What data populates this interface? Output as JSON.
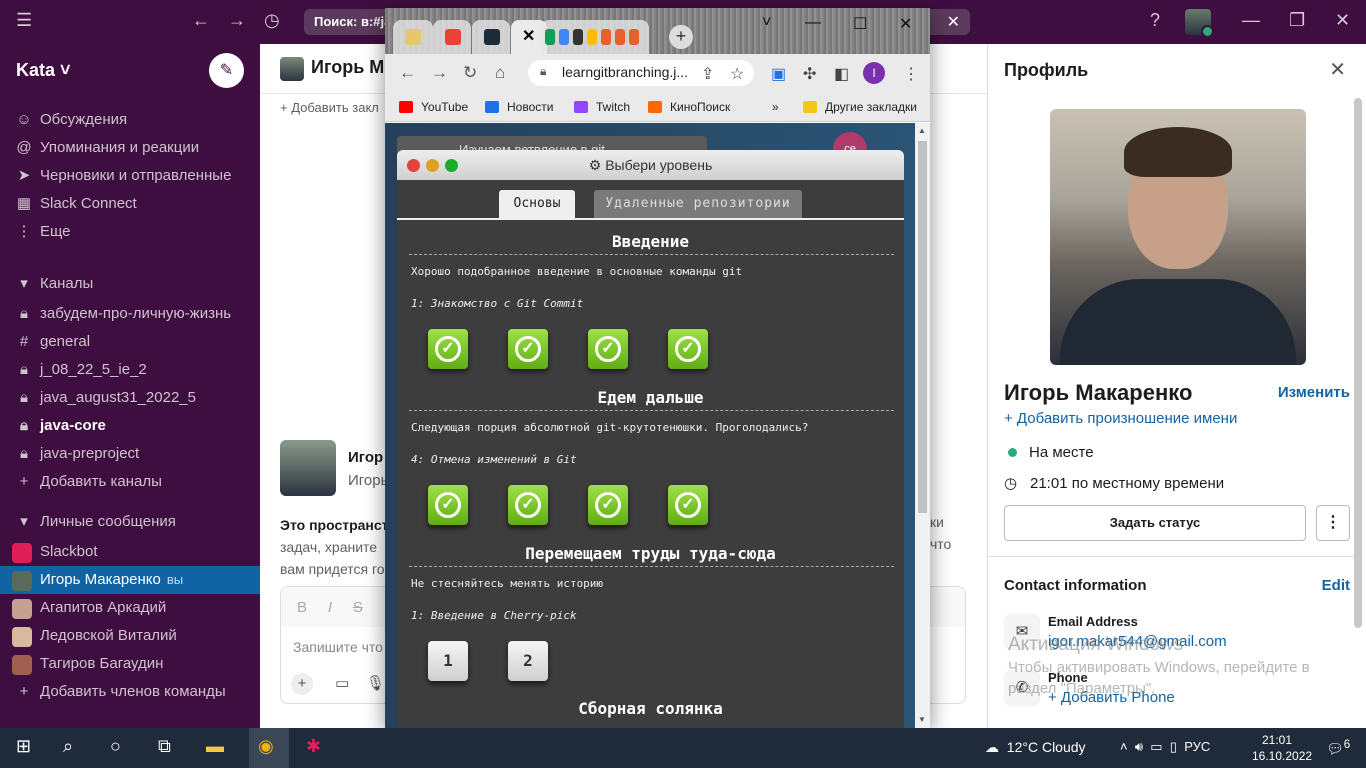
{
  "slack": {
    "search": "Поиск: в:#ja",
    "workspace": "Kata",
    "nav": [
      {
        "icon": "threads-icon",
        "label": "Обсуждения"
      },
      {
        "icon": "mentions-icon",
        "label": "Упоминания и реакции"
      },
      {
        "icon": "drafts-icon",
        "label": "Черновики и отправленные"
      },
      {
        "icon": "slack-connect-icon",
        "label": "Slack Connect"
      },
      {
        "icon": "more-icon",
        "label": "Еще"
      }
    ],
    "channels_header": "Каналы",
    "channels": [
      {
        "prefix": "🔒",
        "label": "забудем-про-личную-жизнь"
      },
      {
        "prefix": "#",
        "label": "general"
      },
      {
        "prefix": "🔒",
        "label": "j_08_22_5_ie_2"
      },
      {
        "prefix": "🔒",
        "label": "java_august31_2022_5"
      },
      {
        "prefix": "🔒",
        "label": "java-core"
      },
      {
        "prefix": "🔒",
        "label": "java-preproject"
      }
    ],
    "add_channels": "Добавить каналы",
    "dms_header": "Личные сообщения",
    "dms": [
      {
        "label": "Slackbot",
        "color": "#4a154b"
      },
      {
        "label": "Игорь Макаренко",
        "you": "вы",
        "color": "#5a6a5a"
      },
      {
        "label": "Агапитов Аркадий",
        "color": "#c8a090"
      },
      {
        "label": "Ледовской Виталий",
        "color": "#d8b8a0"
      },
      {
        "label": "Тагиров Багаудин",
        "color": "#a06050"
      }
    ],
    "add_members": "Добавить членов команды"
  },
  "main": {
    "title": "Игорь Ма",
    "bookmark": "+ Добавить закл",
    "intro_name": "Игор",
    "intro_sub": "Игорь",
    "desc_line1_bold": "Это пространст",
    "desc_line2": "задач, храните",
    "desc_line3": "вам придется го",
    "desc_right1": "ки",
    "desc_right2": "что",
    "placeholder": "Запишите что"
  },
  "profile": {
    "header": "Профиль",
    "name": "Игорь Макаренко",
    "edit": "Изменить",
    "pronunciation": "+ Добавить произношение имени",
    "status": "На месте",
    "local_time": "21:01 по местному времени",
    "set_status": "Задать статус",
    "more": "⋮",
    "contact_header": "Contact information",
    "contact_edit": "Edit",
    "email_label": "Email Address",
    "email": "igor.makar544@gmail.com",
    "phone_label": "Phone",
    "add_phone": "+ Добавить Phone",
    "activation_title": "Активация Windows",
    "activation_text": "Чтобы активировать Windows, перейдите в раздел \"Параметры\"."
  },
  "chrome": {
    "url": "learngitbranching.j...",
    "bookmarks": [
      {
        "label": "YouTube",
        "color": "#ff0000"
      },
      {
        "label": "Новости",
        "color": "#1a73e8"
      },
      {
        "label": "Twitch",
        "color": "#9146ff"
      },
      {
        "label": "КиноПоиск",
        "color": "#ff6600"
      }
    ],
    "bookmarks_more": "»",
    "other_bookmarks": "Другие закладки",
    "profile_letter": "I",
    "behind_window": "Изучаем ветвление в git",
    "bubble": "се"
  },
  "levels": {
    "window_title": "⚙ Выбери уровень",
    "tab_main": "Основы",
    "tab_remote": "Удаленные репозитории",
    "sections": [
      {
        "title": "Введение",
        "desc": "Хорошо подобранное введение в основные команды git",
        "sub": "1: Знакомство с Git Commit",
        "buttons": [
          "✓",
          "✓",
          "✓",
          "✓"
        ],
        "done": true
      },
      {
        "title": "Едем дальше",
        "desc": "Следующая порция абсолютной git-крутотенюшки. Проголодались?",
        "sub": "4: Отмена изменений в Git",
        "buttons": [
          "✓",
          "✓",
          "✓",
          "✓"
        ],
        "done": true
      },
      {
        "title": "Перемещаем труды туда-сюда",
        "desc": "Не стесняйтесь менять историю",
        "sub": "1: Введение в Cherry-pick",
        "buttons": [
          "1",
          "2"
        ],
        "done": false
      },
      {
        "title": "Сборная солянка",
        "desc": "",
        "sub": "",
        "buttons": [],
        "done": false
      }
    ]
  },
  "taskbar": {
    "weather": "12°C  Cloudy",
    "lang": "РУС",
    "time": "21:01",
    "date": "16.10.2022",
    "notifications": "6"
  }
}
